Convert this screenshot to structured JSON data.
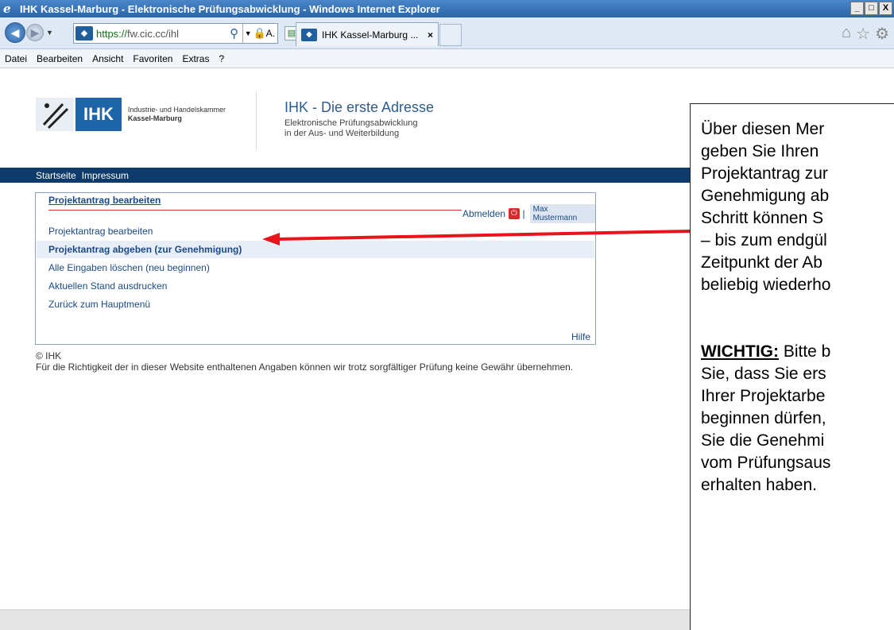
{
  "window": {
    "title": "IHK Kassel-Marburg - Elektronische Prüfungsabwicklung - Windows Internet Explorer",
    "controls": [
      "_",
      "□",
      "X"
    ]
  },
  "addressbar": {
    "url_https": "https://",
    "url_rest": "fw.cic.cc/ihl",
    "cert_text": "A.",
    "tab_title": "IHK Kassel-Marburg ...",
    "tab_close": "×"
  },
  "menubar": [
    "Datei",
    "Bearbeiten",
    "Ansicht",
    "Favoriten",
    "Extras",
    "?"
  ],
  "header": {
    "logo_ihk": "IHK",
    "logo_line1": "Industrie- und Handelskammer",
    "logo_line2": "Kassel-Marburg",
    "title": "IHK - Die erste Adresse",
    "subtitle_1": "Elektronische Prüfungsabwicklung",
    "subtitle_2": "in der Aus- und Weiterbildung"
  },
  "nav": [
    "Startseite",
    "Impressum"
  ],
  "panel": {
    "title": "Projektantrag bearbeiten",
    "logout": "Abmelden",
    "user": "Max Mustermann",
    "items": [
      "Projektantrag bearbeiten",
      "Projektantrag abgeben (zur Genehmigung)",
      "Alle Eingaben löschen (neu beginnen)",
      "Aktuellen Stand ausdrucken",
      "Zurück zum Hauptmenü"
    ],
    "help": "Hilfe"
  },
  "footer": {
    "copyright": "© IHK",
    "disclaimer": "Für die Richtigkeit der in dieser Website enthaltenen Angaben können wir trotz sorgfältiger Prüfung keine Gewähr übernehmen."
  },
  "annotation": {
    "lines": [
      "Über diesen Mer",
      "geben Sie Ihren",
      "Projektantrag zur",
      "Genehmigung ab",
      "Schritt können S",
      "– bis zum endgül",
      "Zeitpunkt der Ab",
      "beliebig wiederho"
    ],
    "warning_label": "WICHTIG:",
    "warning_first": " Bitte b",
    "warning_lines": [
      "Sie, dass Sie ers",
      "Ihrer Projektarbe",
      "beginnen dürfen,",
      "Sie die Genehmi",
      "vom Prüfungsaus",
      "erhalten haben."
    ],
    "arrow_color": "#e8141b"
  }
}
